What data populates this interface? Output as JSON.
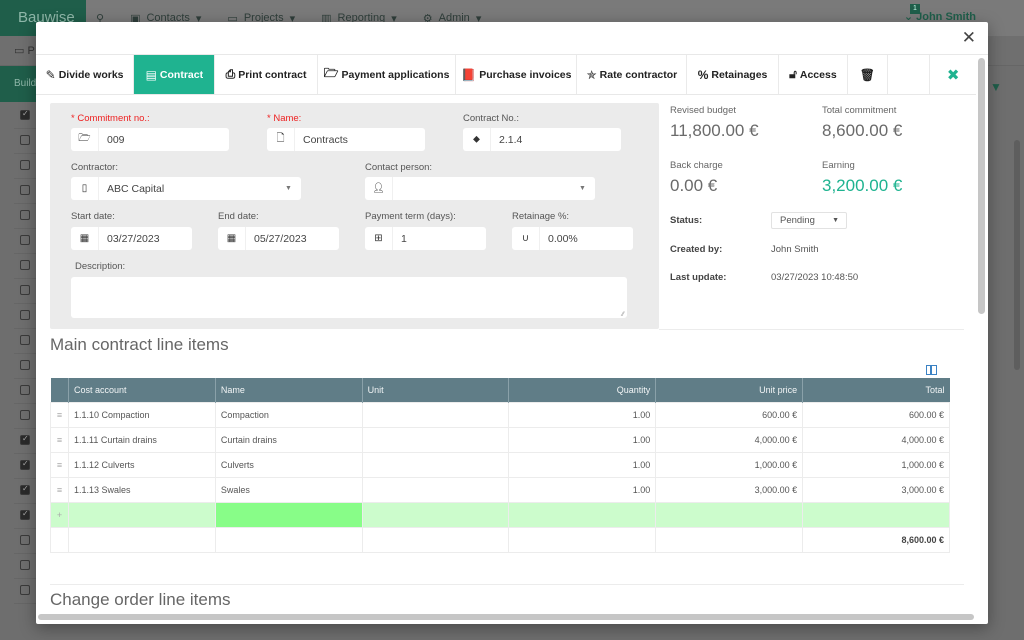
{
  "app": {
    "brand": "Bauwise",
    "nav": [
      {
        "icon": "search-icon",
        "label": ""
      },
      {
        "icon": "contacts-icon",
        "label": "Contacts"
      },
      {
        "icon": "folder-icon",
        "label": "Projects"
      },
      {
        "icon": "chart-icon",
        "label": "Reporting"
      },
      {
        "icon": "gear-icon",
        "label": "Admin"
      }
    ],
    "notification_count": "1",
    "user_name": "John Smith",
    "subtab_label": "P",
    "side_label": "Build"
  },
  "toolbar": {
    "divide_works": "Divide works",
    "contract": "Contract",
    "print_contract": "Print contract",
    "payment_applications": "Payment applications",
    "purchase_invoices": "Purchase invoices",
    "rate_contractor": "Rate contractor",
    "retainages": "Retainages",
    "access": "Access"
  },
  "form": {
    "commitment_no": {
      "label": "* Commitment no.:",
      "value": "009"
    },
    "name": {
      "label": "* Name:",
      "value": "Contracts"
    },
    "contract_no": {
      "label": "Contract No.:",
      "value": "2.1.4"
    },
    "contractor": {
      "label": "Contractor:",
      "value": "ABC Capital"
    },
    "contact_person": {
      "label": "Contact person:",
      "value": ""
    },
    "start_date": {
      "label": "Start date:",
      "value": "03/27/2023"
    },
    "end_date": {
      "label": "End date:",
      "value": "05/27/2023"
    },
    "payment_term": {
      "label": "Payment term (days):",
      "value": "1"
    },
    "retainage": {
      "label": "Retainage %:",
      "value": "0.00%"
    },
    "description": {
      "label": "Description:",
      "value": ""
    }
  },
  "summary": {
    "revised_budget": {
      "label": "Revised budget",
      "value": "11,800.00 €"
    },
    "total_commitment": {
      "label": "Total commitment",
      "value": "8,600.00 €"
    },
    "back_charge": {
      "label": "Back charge",
      "value": "0.00 €"
    },
    "earning": {
      "label": "Earning",
      "value": "3,200.00 €"
    },
    "status": {
      "label": "Status:",
      "value": "Pending"
    },
    "created_by": {
      "label": "Created by:",
      "value": "John Smith"
    },
    "last_update": {
      "label": "Last update:",
      "value": "03/27/2023 10:48:50"
    }
  },
  "main_items": {
    "title": "Main contract line items",
    "columns": [
      "Cost account",
      "Name",
      "Unit",
      "Quantity",
      "Unit price",
      "Total"
    ],
    "rows": [
      {
        "cost_account": "1.1.10 Compaction",
        "name": "Compaction",
        "unit": "",
        "quantity": "1.00",
        "unit_price": "600.00 €",
        "total": "600.00 €"
      },
      {
        "cost_account": "1.1.11 Curtain drains",
        "name": "Curtain drains",
        "unit": "",
        "quantity": "1.00",
        "unit_price": "4,000.00 €",
        "total": "4,000.00 €"
      },
      {
        "cost_account": "1.1.12 Culverts",
        "name": "Culverts",
        "unit": "",
        "quantity": "1.00",
        "unit_price": "1,000.00 €",
        "total": "1,000.00 €"
      },
      {
        "cost_account": "1.1.13 Swales",
        "name": "Swales",
        "unit": "",
        "quantity": "1.00",
        "unit_price": "3,000.00 €",
        "total": "3,000.00 €"
      }
    ],
    "grand_total": "8,600.00 €"
  },
  "change_items": {
    "title": "Change order line items"
  },
  "colors": {
    "accent": "#1fb390",
    "table_header": "#607d87",
    "new_row": "#ccfccc",
    "editing_cell": "#88fd88",
    "required": "#ee2222"
  }
}
